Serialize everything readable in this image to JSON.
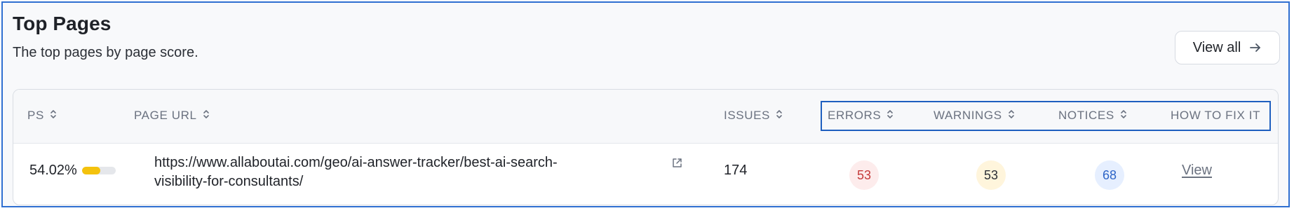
{
  "header": {
    "title": "Top Pages",
    "subtitle": "The top pages by page score.",
    "view_all_label": "View all"
  },
  "table": {
    "columns": [
      {
        "key": "ps",
        "label": "PS"
      },
      {
        "key": "page_url",
        "label": "PAGE URL"
      },
      {
        "key": "issues",
        "label": "ISSUES"
      },
      {
        "key": "errors",
        "label": "ERRORS"
      },
      {
        "key": "warnings",
        "label": "WARNINGS"
      },
      {
        "key": "notices",
        "label": "NOTICES"
      },
      {
        "key": "how_to_fix",
        "label": "HOW TO FIX IT"
      }
    ],
    "rows": [
      {
        "ps": "54.02%",
        "ps_fraction": 0.5402,
        "page_url_line1": "https://www.allaboutai.com/geo/ai-answer-tracker/best-ai-search-",
        "page_url_line2": "visibility-for-consultants/",
        "issues": "174",
        "errors": "53",
        "warnings": "53",
        "notices": "68",
        "how_to_fix_label": "View"
      }
    ]
  },
  "colors": {
    "highlight_border": "#1f5fbf",
    "ps_bar_fill": "#f4c20d",
    "errors_badge_bg": "#fdecec",
    "errors_badge_text": "#c53a3a",
    "warnings_badge_bg": "#fff5dc",
    "notices_badge_bg": "#e6efff",
    "notices_badge_text": "#2e65c7"
  },
  "icons": {
    "view_all": "arrow-right-icon",
    "sort": "sort-icon",
    "external_link": "external-link-icon"
  }
}
